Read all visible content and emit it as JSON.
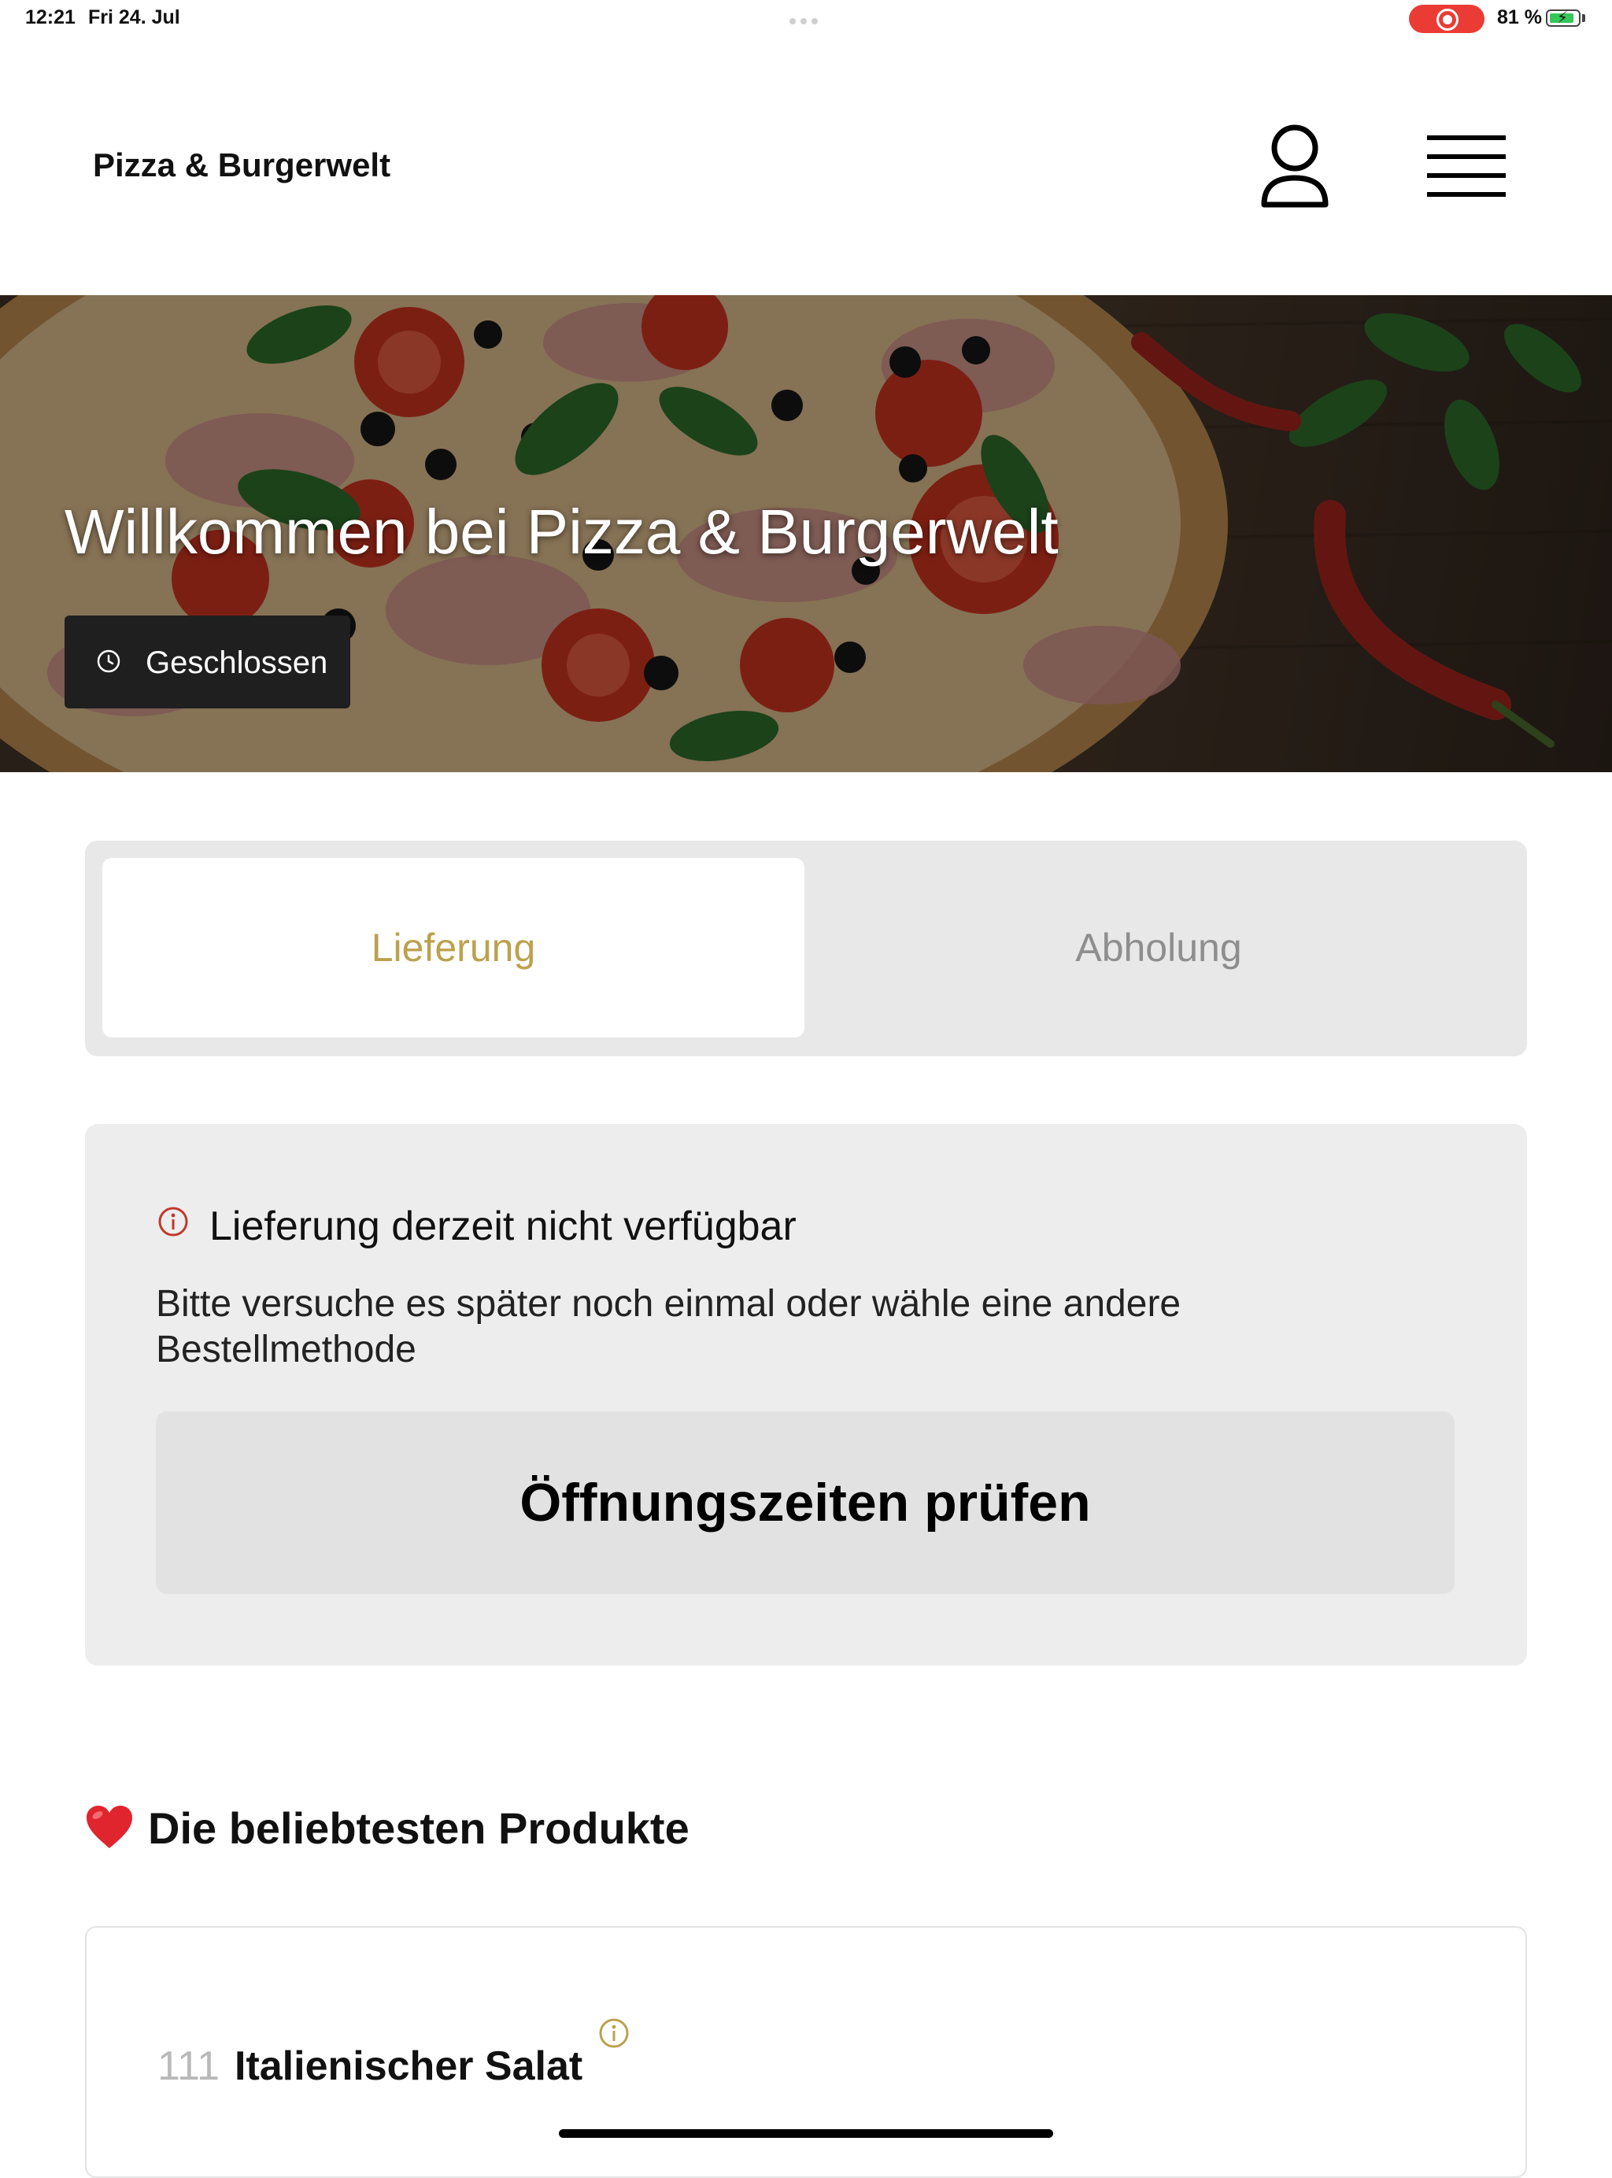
{
  "status_bar": {
    "time": "12:21",
    "date": "Fri 24. Jul",
    "battery": "81 %"
  },
  "header": {
    "title": "Pizza & Burgerwelt"
  },
  "hero": {
    "title": "Willkommen bei Pizza & Burgerwelt",
    "status": "Geschlossen"
  },
  "order_method": {
    "delivery_label": "Lieferung",
    "pickup_label": "Abholung",
    "active": "Lieferung"
  },
  "notice": {
    "title": "Lieferung derzeit nicht verfügbar",
    "text": "Bitte versuche es später noch einmal oder wähle eine andere Bestellmethode",
    "button_label": "Öffnungszeiten prüfen"
  },
  "popular": {
    "title": "Die beliebtesten Produkte",
    "items": [
      {
        "number": "111",
        "name": "Italienischer Salat"
      }
    ]
  },
  "colors": {
    "accent": "#bca14e",
    "notice_icon": "#c0392b",
    "recording": "#eb3b35",
    "battery_fill": "#34c759"
  }
}
